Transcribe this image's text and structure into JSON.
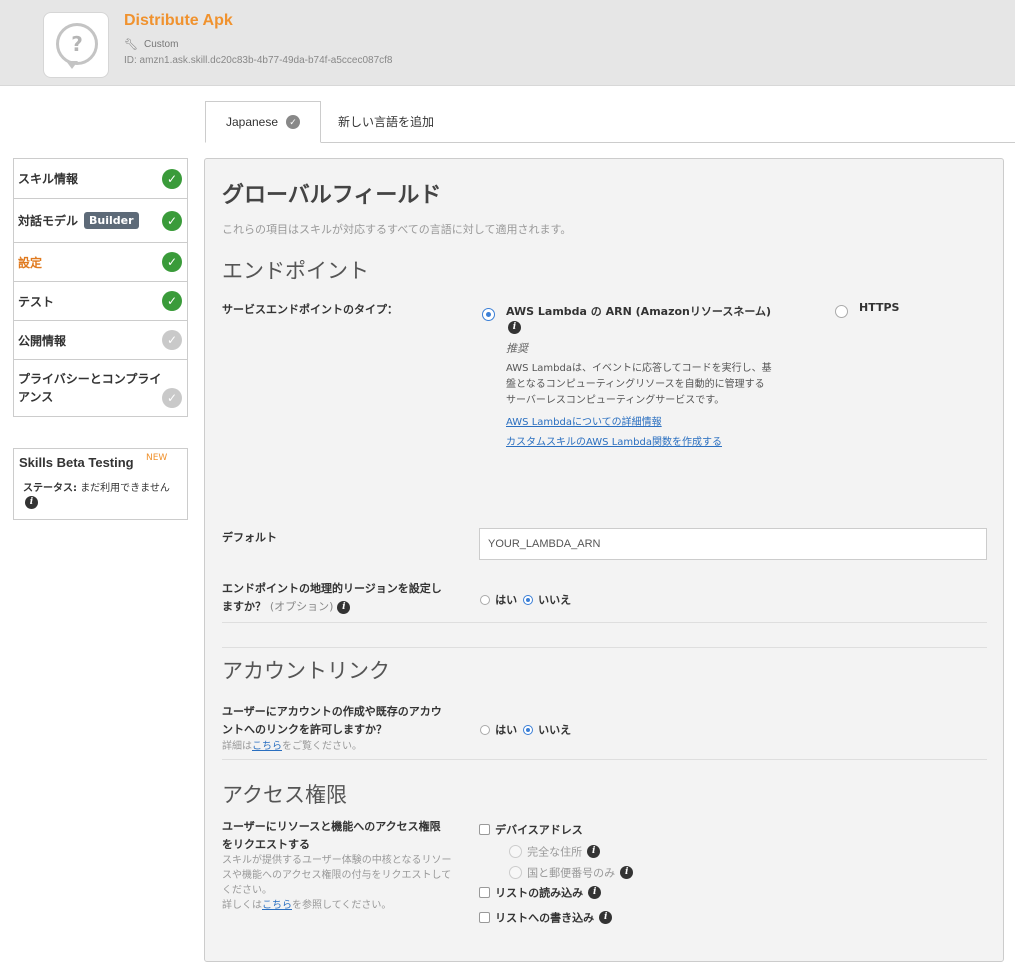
{
  "header": {
    "title": "Distribute Apk",
    "type_label": "Custom",
    "skill_id": "ID:   amzn1.ask.skill.dc20c83b-4b77-49da-b74f-a5ccec087cf8",
    "logo_glyph": "?"
  },
  "tabs": {
    "active_label": "Japanese",
    "add_label": "新しい言語を追加"
  },
  "sidebar": {
    "items": [
      {
        "label": "スキル情報",
        "status": "complete"
      },
      {
        "label": "対話モデル",
        "badge": "Builder",
        "status": "complete"
      },
      {
        "label": "設定",
        "status": "complete",
        "active": true
      },
      {
        "label": "テスト",
        "status": "complete"
      },
      {
        "label": "公開情報",
        "status": "incomplete"
      },
      {
        "label": "プライバシーとコンプライアンス",
        "status": "incomplete"
      }
    ]
  },
  "beta": {
    "title": "Skills Beta Testing",
    "new_badge": "NEW",
    "status_label": "ステータス:",
    "status_value": "まだ利用できません"
  },
  "main": {
    "title": "グローバルフィールド",
    "subtitle": "これらの項目はスキルが対応するすべての言語に対して適用されます。",
    "endpoint": {
      "heading": "エンドポイント",
      "type_label": "サービスエンドポイントのタイプ：",
      "lambda_label": "AWS Lambda の ARN (Amazonリソースネーム)",
      "recommended": "推奨",
      "lambda_desc_1": "AWS Lambdaは、イベントに応答してコードを実行し、基",
      "lambda_desc_2": "盤となるコンピューティングリソースを自動的に管理する",
      "lambda_desc_3": "サーバーレスコンピューティングサービスです。",
      "link_details": "AWS Lambdaについての詳細情報",
      "link_create": "カスタムスキルのAWS Lambda関数を作成する",
      "https_label": "HTTPS",
      "selected": "lambda",
      "default_label": "デフォルト",
      "default_value": "YOUR_LAMBDA_ARN",
      "region_label_1": "エンドポイントの地理的リージョンを設定し",
      "region_label_2": "ますか？",
      "region_optional": "(オプション)",
      "yes": "はい",
      "no": "いいえ",
      "region_selected": "no"
    },
    "account": {
      "heading": "アカウントリンク",
      "question_1": "ユーザーにアカウントの作成や既存のアカウ",
      "question_2": "ントへのリンクを許可しますか？",
      "detail_prefix": "詳細は",
      "detail_link": "こちら",
      "detail_suffix": "をご覧ください。",
      "yes": "はい",
      "no": "いいえ",
      "selected": "no"
    },
    "permissions": {
      "heading": "アクセス権限",
      "label_1": "ユーザーにリソースと機能へのアクセス権限",
      "label_2": "をリクエストする",
      "desc_1": "スキルが提供するユーザー体験の中核となるリソー",
      "desc_2": "スや機能へのアクセス権限の付与をリクエストして",
      "desc_3": "ください。",
      "more_prefix": "詳しくは",
      "more_link": "こちら",
      "more_suffix": "を参照してください。",
      "device_address": "デバイスアドレス",
      "full_address": "完全な住所",
      "country_postal": "国と郵便番号のみ",
      "list_read": "リストの読み込み",
      "list_write": "リストへの書き込み"
    }
  },
  "colors": {
    "accent_orange": "#f0922e",
    "check_green": "#3a9b3a",
    "link_blue": "#2a6fc0",
    "radio_blue": "#3b7fd6"
  }
}
